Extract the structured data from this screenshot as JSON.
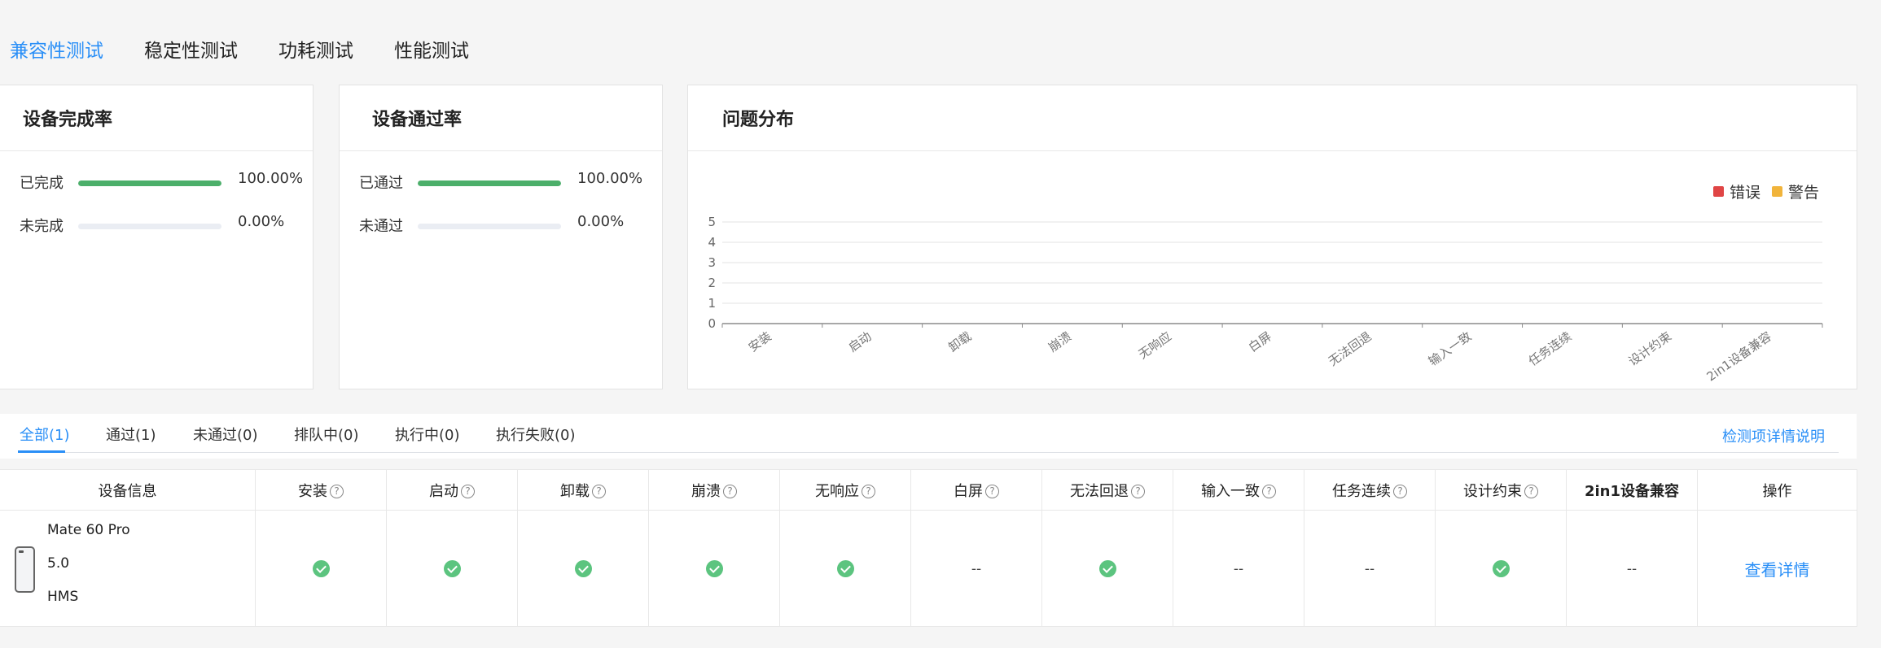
{
  "top_tabs": [
    "兼容性测试",
    "稳定性测试",
    "功耗测试",
    "性能测试"
  ],
  "completion_card": {
    "title": "设备完成率",
    "rows": [
      {
        "label": "已完成",
        "value": "100.00%",
        "fraction": 1.0
      },
      {
        "label": "未完成",
        "value": "0.00%",
        "fraction": 0.0
      }
    ]
  },
  "pass_card": {
    "title": "设备通过率",
    "rows": [
      {
        "label": "已通过",
        "value": "100.00%",
        "fraction": 1.0
      },
      {
        "label": "未通过",
        "value": "0.00%",
        "fraction": 0.0
      }
    ]
  },
  "issue_card": {
    "title": "问题分布",
    "legend": [
      {
        "label": "错误",
        "color": "#e04545"
      },
      {
        "label": "警告",
        "color": "#f1b43b"
      }
    ]
  },
  "chart_data": {
    "type": "bar",
    "title": "问题分布",
    "categories": [
      "安装",
      "启动",
      "卸载",
      "崩溃",
      "无响应",
      "白屏",
      "无法回退",
      "输入一致",
      "任务连续",
      "设计约束",
      "2in1设备兼容"
    ],
    "series": [
      {
        "name": "错误",
        "color": "#e04545",
        "values": [
          0,
          0,
          0,
          0,
          0,
          0,
          0,
          0,
          0,
          0,
          0
        ]
      },
      {
        "name": "警告",
        "color": "#f1b43b",
        "values": [
          0,
          0,
          0,
          0,
          0,
          0,
          0,
          0,
          0,
          0,
          0
        ]
      }
    ],
    "yticks": [
      "0",
      "1",
      "2",
      "3",
      "4",
      "5"
    ],
    "ylim": [
      0,
      5
    ],
    "grid": true,
    "legend_position": "top-right"
  },
  "filter_tabs": [
    "全部(1)",
    "通过(1)",
    "未通过(0)",
    "排队中(0)",
    "执行中(0)",
    "执行失败(0)"
  ],
  "detail_link": "检测项详情说明",
  "table": {
    "headers": [
      "设备信息",
      "安装",
      "启动",
      "卸载",
      "崩溃",
      "无响应",
      "白屏",
      "无法回退",
      "输入一致",
      "任务连续",
      "设计约束",
      "2in1设备兼容",
      "操作"
    ],
    "help_columns": [
      1,
      2,
      3,
      4,
      5,
      6,
      7,
      8,
      9,
      10
    ],
    "row": {
      "device": {
        "name": "Mate 60 Pro",
        "version": "5.0",
        "os": "HMS"
      },
      "results": [
        "pass",
        "pass",
        "pass",
        "pass",
        "pass",
        "--",
        "pass",
        "--",
        "--",
        "pass",
        "--"
      ],
      "dash_text": "--",
      "action": "查看详情"
    }
  }
}
